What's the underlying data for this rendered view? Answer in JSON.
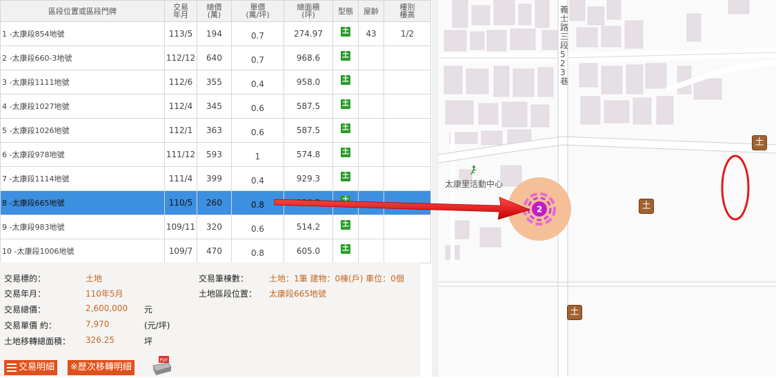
{
  "table": {
    "headers": {
      "addr": "區段位置或區段門牌",
      "date": [
        "交易",
        "年月"
      ],
      "total": [
        "總價",
        "(萬)"
      ],
      "unit": [
        "單價",
        "(萬/坪)"
      ],
      "area": [
        "總面積",
        "(坪)"
      ],
      "type": "型態",
      "age": "屋齡",
      "floor": [
        "樓別",
        "樓高"
      ]
    },
    "rows": [
      {
        "addr": "1  -太康段854地號",
        "date": "113/5",
        "total": "194",
        "unit": "0.7",
        "area": "274.97",
        "type": "土",
        "age": "43",
        "floor": "1/2"
      },
      {
        "addr": "2  -太康段660-3地號",
        "date": "112/12",
        "total": "640",
        "unit": "0.7",
        "area": "968.6",
        "type": "土",
        "age": "",
        "floor": ""
      },
      {
        "addr": "3  -太康段1111地號",
        "date": "112/6",
        "total": "355",
        "unit": "0.4",
        "area": "958.0",
        "type": "土",
        "age": "",
        "floor": ""
      },
      {
        "addr": "4  -太康段1027地號",
        "date": "112/4",
        "total": "345",
        "unit": "0.6",
        "area": "587.5",
        "type": "土",
        "age": "",
        "floor": ""
      },
      {
        "addr": "5  -太康段1026地號",
        "date": "112/1",
        "total": "363",
        "unit": "0.6",
        "area": "587.5",
        "type": "土",
        "age": "",
        "floor": ""
      },
      {
        "addr": "6  -太康段978地號",
        "date": "111/12",
        "total": "593",
        "unit": "1",
        "area": "574.8",
        "type": "土",
        "age": "",
        "floor": ""
      },
      {
        "addr": "7  -太康段1114地號",
        "date": "111/4",
        "total": "399",
        "unit": "0.4",
        "area": "929.3",
        "type": "土",
        "age": "",
        "floor": ""
      },
      {
        "addr": "8  -太康段665地號",
        "date": "110/5",
        "total": "260",
        "unit": "0.8",
        "area": "326.3",
        "type": "土",
        "age": "",
        "floor": "",
        "selected": true
      },
      {
        "addr": "9  -太康段983地號",
        "date": "109/11",
        "total": "320",
        "unit": "0.6",
        "area": "514.2",
        "type": "土",
        "age": "",
        "floor": ""
      },
      {
        "addr": "10  -太康段1006地號",
        "date": "109/7",
        "total": "470",
        "unit": "0.8",
        "area": "605.0",
        "type": "土",
        "age": "",
        "floor": ""
      }
    ]
  },
  "detail": {
    "subject_label": "交易標的：",
    "subject_value": "土地",
    "date_label": "交易年月：",
    "date_value": "110年5月",
    "total_label": "交易總價：",
    "total_value": "2,600,000",
    "total_unit": "元",
    "unit_label": "交易單價 約：",
    "unit_value": "7,970",
    "unit_unit": "(元/坪)",
    "area_label": "土地移轉總面積：",
    "area_value": "326.25",
    "area_unit": "坪",
    "count_label": "交易筆棟數：",
    "count_value": "土地：1筆 建物：0棟(戶) 車位：0個",
    "location_label": "土地區段位置：",
    "location_value": "太康段665地號"
  },
  "buttons": {
    "detail": "交易明細",
    "history": "※歷次移轉明細",
    "pdf": "PDF"
  },
  "map": {
    "road_label": "義士路三段523巷",
    "poi_label": "太康里活動中心",
    "cluster_count": "2",
    "lot_badge": "土"
  },
  "colors": {
    "selected_row": "#3d8fe0",
    "type_badge": "#2a9d2a",
    "value_text": "#c4661f",
    "button": "#e0501a",
    "arrow": "#ff1a1a",
    "cluster": "#d321d3"
  }
}
